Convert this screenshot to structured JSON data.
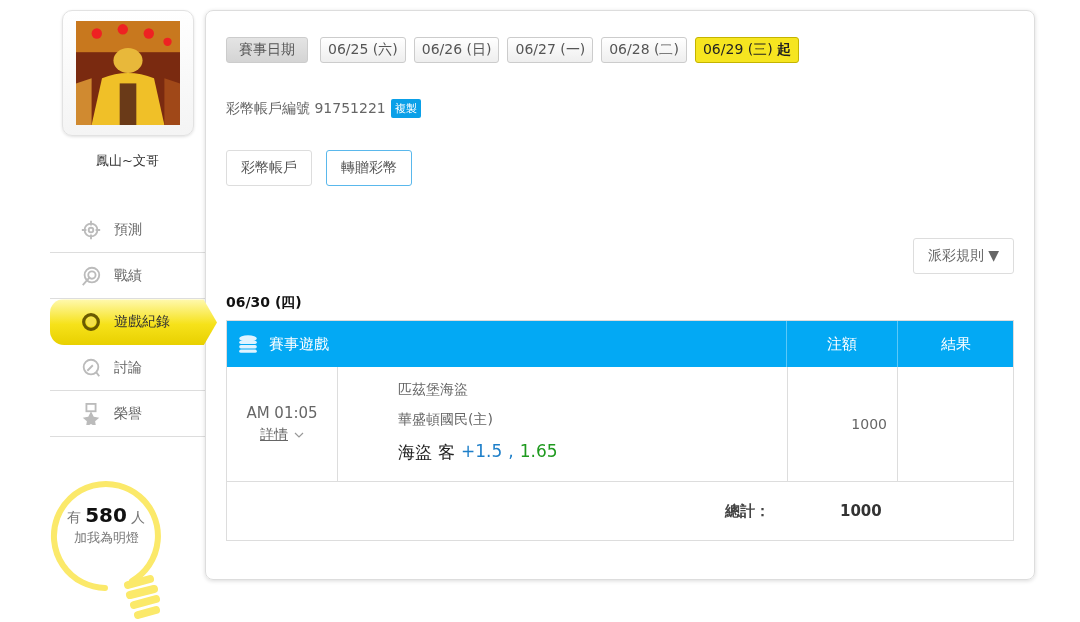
{
  "profile": {
    "name": "鳳山~文哥"
  },
  "sidebar": {
    "items": [
      {
        "label": "預測",
        "kind": "target",
        "selected": false
      },
      {
        "label": "戰績",
        "kind": "record",
        "selected": false
      },
      {
        "label": "遊戲紀錄",
        "kind": "ring",
        "selected": true
      },
      {
        "label": "討論",
        "kind": "chat",
        "selected": false
      },
      {
        "label": "榮譽",
        "kind": "medal",
        "selected": false
      }
    ]
  },
  "fans": {
    "prefix": "有",
    "count": "580",
    "suffix": "人",
    "caption": "加我為明燈"
  },
  "date_filter": {
    "label": "賽事日期",
    "dates": [
      {
        "label": "06/25 (六)",
        "selected": false
      },
      {
        "label": "06/26 (日)",
        "selected": false
      },
      {
        "label": "06/27 (一)",
        "selected": false
      },
      {
        "label": "06/28 (二)",
        "selected": false
      },
      {
        "label": "06/29 (三)",
        "suffix": "起",
        "selected": true
      }
    ]
  },
  "account": {
    "text": "彩幣帳戶編號 91751221",
    "copy_button": "複製"
  },
  "tabs": [
    {
      "label": "彩幣帳戶",
      "selected": false
    },
    {
      "label": "轉贈彩幣",
      "selected": true
    }
  ],
  "rules_button": "派彩規則 ▼",
  "day": "06/30 (四)",
  "table": {
    "columns": [
      "賽事遊戲",
      "注額",
      "結果"
    ],
    "rows": [
      {
        "time": "AM 01:05",
        "details": "詳情",
        "away": "匹茲堡海盜",
        "home": "華盛頓國民(主)",
        "pick": {
          "team": "海盜",
          "side": "客",
          "line": "+1.5",
          "separator": ",",
          "odds": "1.65"
        },
        "stake": "1000"
      }
    ],
    "total_label": "總計：",
    "total": "1000"
  }
}
